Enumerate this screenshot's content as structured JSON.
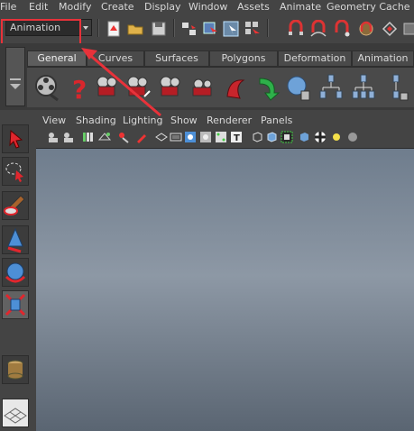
{
  "menu": {
    "items": [
      "File",
      "Edit",
      "Modify",
      "Create",
      "Display",
      "Window",
      "Assets",
      "Animate",
      "Geometry Cache"
    ]
  },
  "toolbar": {
    "mode_selector_value": "Animation"
  },
  "shelf": {
    "tabs": [
      "General",
      "Curves",
      "Surfaces",
      "Polygons",
      "Deformation",
      "Animation"
    ],
    "active_tab": "General"
  },
  "panel_menu": {
    "items": [
      "View",
      "Shading",
      "Lighting",
      "Show",
      "Renderer",
      "Panels"
    ]
  },
  "colors": {
    "highlight": "#e8323a",
    "background": "#444444",
    "viewport_top": "#6f7d8d",
    "viewport_bottom": "#5a6572"
  }
}
